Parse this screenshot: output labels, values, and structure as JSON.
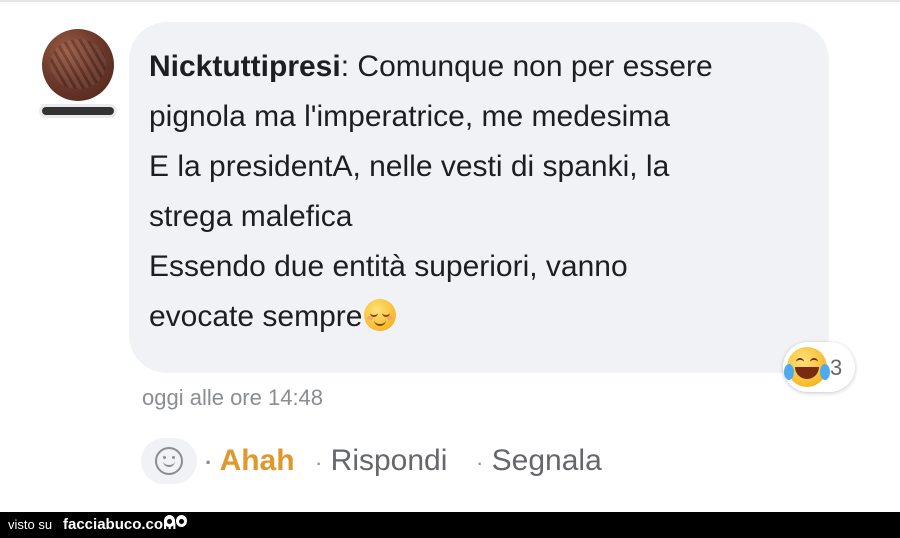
{
  "comment": {
    "author": "Nicktuttipresi",
    "separator": ":",
    "lines": [
      " Comunque non per essere",
      "pignola ma l'imperatrice, me medesima",
      "E la presidentA, nelle vesti di spanki, la",
      "strega malefica",
      "Essendo due entità superiori, vanno",
      "evocate sempre"
    ],
    "trailing_emoji": "relieved-face-emoji"
  },
  "reactions": {
    "emoji": "face-with-tears-of-joy",
    "count": "3"
  },
  "timestamp": "oggi alle ore 14:48",
  "actions": {
    "separator": "·",
    "ahah": "Ahah",
    "rispondi": "Rispondi",
    "segnala": "Segnala"
  },
  "footer": {
    "visto_su": "visto su",
    "site": "facciabuco.com"
  },
  "colors": {
    "bubble_bg": "#f0f2f5",
    "ahah_color": "#e0982a",
    "muted_text": "#65676b"
  }
}
